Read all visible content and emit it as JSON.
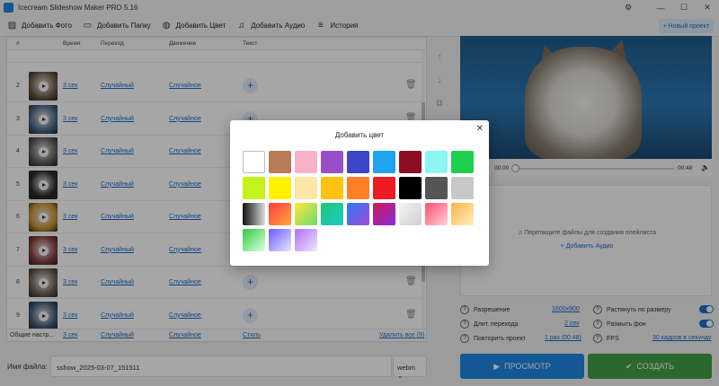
{
  "window": {
    "title": "Icecream Slideshow Maker PRO 5.16"
  },
  "toolbar": {
    "add_photo": "Добавить Фото",
    "add_folder": "Добавить Папку",
    "add_color": "Добавить Цвет",
    "add_audio": "Добавить Аудио",
    "history": "История",
    "new_project": "+ Новый проект"
  },
  "table": {
    "headers": {
      "num": "#",
      "time": "Время",
      "transition": "Переход",
      "movement": "Движение",
      "text": "Текст"
    },
    "rows": [
      {
        "num": "2",
        "time": "3 сек",
        "transition": "Случайный",
        "movement": "Случайное"
      },
      {
        "num": "3",
        "time": "3 сек",
        "transition": "Случайный",
        "movement": "Случайное"
      },
      {
        "num": "4",
        "time": "3 сек",
        "transition": "Случайный",
        "movement": "Случайное"
      },
      {
        "num": "5",
        "time": "3 сек",
        "transition": "Случайный",
        "movement": "Случайное"
      },
      {
        "num": "6",
        "time": "3 сек",
        "transition": "Случайный",
        "movement": "Случайное"
      },
      {
        "num": "7",
        "time": "3 сек",
        "transition": "Случайный",
        "movement": "Случайное"
      },
      {
        "num": "8",
        "time": "3 сек",
        "transition": "Случайный",
        "movement": "Случайное"
      },
      {
        "num": "9",
        "time": "3 сек",
        "transition": "Случайный",
        "movement": "Случайное"
      }
    ],
    "footer": {
      "general": "Общие настр...",
      "time": "3 сек",
      "transition": "Случайный",
      "movement": "Случайное",
      "style": "Стиль",
      "delete_all": "Удалить все (9)"
    }
  },
  "file": {
    "label": "Имя файла:",
    "name": "sshow_2025-03-07_151511",
    "format": "webm"
  },
  "player": {
    "current": "00:00",
    "total": "00:48"
  },
  "audio": {
    "hint": "Перетащите файлы для создания плейлиста",
    "add_audio": "Добавить Аудио"
  },
  "settings": {
    "resolution_label": "Разрешение",
    "resolution_value": "1600x900",
    "transition_label": "Длит. перехода",
    "transition_value": "2 сек",
    "repeat_label": "Повторить проект",
    "repeat_value": "1 раз (00:48)",
    "stretch_label": "Растянуть по размеру",
    "blur_label": "Размыть фон",
    "fps_label": "FPS",
    "fps_value": "30 кадров в секунду"
  },
  "buttons": {
    "preview": "ПРОСМОТР",
    "create": "СОЗДАТЬ"
  },
  "modal": {
    "title": "Добавить цвет",
    "swatches": [
      "#ffffff",
      "#b97a57",
      "#f8b2c8",
      "#9a4fc9",
      "#3d45c8",
      "#1ea3ec",
      "#8b0e25",
      "#8ff4f4",
      "#1ecf4e",
      "#c6f21c",
      "#fff200",
      "#fbe6a6",
      "#ffc20e",
      "#ff7f27",
      "#ed1c24",
      "#000000",
      "#555555",
      "#c8c8c8",
      "linear-gradient(90deg,#111,#ddd)",
      "linear-gradient(135deg,#ff3d3d,#ffa63d)",
      "linear-gradient(135deg,#ffe83d,#6fd96f)",
      "linear-gradient(135deg,#1dc96f,#1dc9c9)",
      "linear-gradient(135deg,#2d7bf0,#a04ad9)",
      "linear-gradient(135deg,#c91d4f,#8a2be2)",
      "linear-gradient(135deg,#f4f4f4,#cfcfcf)",
      "linear-gradient(135deg,#ff4f6d,#ffd0d8)",
      "linear-gradient(135deg,#ffb347,#fff0c0)",
      "linear-gradient(135deg,#2ecc40,#e0ffe0)",
      "linear-gradient(135deg,#6a5af9,#e8e8ff)",
      "linear-gradient(135deg,#b06ef5,#f0e6ff)"
    ]
  }
}
